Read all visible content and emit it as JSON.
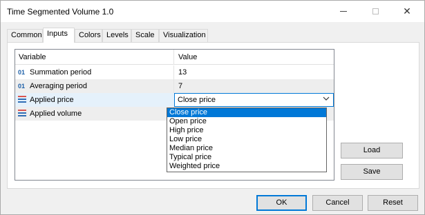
{
  "window": {
    "title": "Time Segmented Volume 1.0",
    "controls": {
      "minimize": "minimize",
      "maximize": "maximize",
      "close": "✕"
    }
  },
  "tabs": [
    {
      "label": "Common",
      "active": false
    },
    {
      "label": "Inputs",
      "active": true
    },
    {
      "label": "Colors",
      "active": false
    },
    {
      "label": "Levels",
      "active": false
    },
    {
      "label": "Scale",
      "active": false
    },
    {
      "label": "Visualization",
      "active": false
    }
  ],
  "grid": {
    "headers": {
      "variable": "Variable",
      "value": "Value"
    },
    "rows": [
      {
        "icon": "01",
        "type": "integer",
        "name": "Summation period",
        "value": "13"
      },
      {
        "icon": "01",
        "type": "integer",
        "name": "Averaging period",
        "value": "7"
      },
      {
        "icon": "list-icon",
        "type": "enum",
        "name": "Applied price",
        "value": "Close price"
      },
      {
        "icon": "list-icon",
        "type": "enum",
        "name": "Applied volume",
        "value": ""
      }
    ]
  },
  "dropdown": {
    "options": [
      "Close price",
      "Open price",
      "High price",
      "Low price",
      "Median price",
      "Typical price",
      "Weighted price"
    ],
    "selected": "Close price"
  },
  "buttons": {
    "load": "Load",
    "save": "Save",
    "ok": "OK",
    "cancel": "Cancel",
    "reset": "Reset"
  },
  "colors": {
    "accent": "#0078d7",
    "int_icon": "#1c5fa8",
    "enum_icon_a": "#d9534f",
    "enum_icon_b": "#2f6db5"
  }
}
